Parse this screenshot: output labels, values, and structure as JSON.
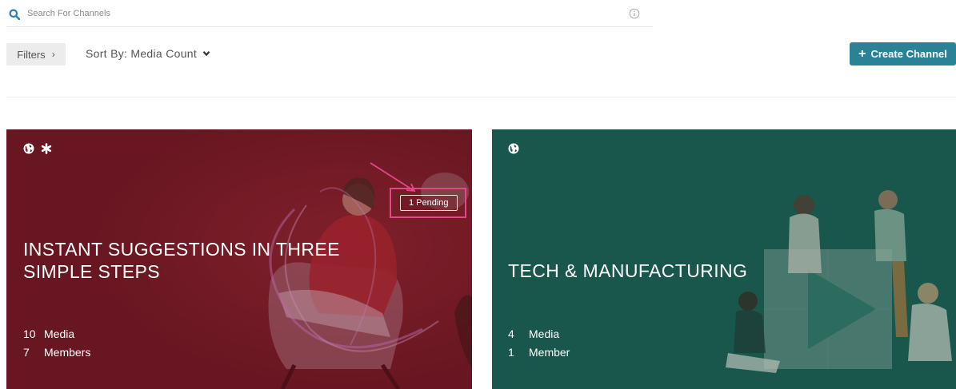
{
  "search": {
    "placeholder": "Search For Channels",
    "value": ""
  },
  "toolbar": {
    "filters_label": "Filters",
    "sort_label": "Sort By: Media Count",
    "create_label": "Create Channel"
  },
  "colors": {
    "accent": "#2a8296",
    "card_1_background": "#6e1a25",
    "card_2_background": "#1d5c50",
    "highlight": "#e4468a"
  },
  "channels": [
    {
      "title": "INSTANT SUGGESTIONS IN THREE SIMPLE STEPS",
      "icons": [
        "globe-icon",
        "asterisk-icon"
      ],
      "pending_badge": "1 Pending",
      "media_count": "10",
      "media_label": "Media",
      "members_count": "7",
      "members_label": "Members"
    },
    {
      "title": "TECH & MANUFACTURING",
      "icons": [
        "globe-icon"
      ],
      "media_count": "4",
      "media_label": "Media",
      "members_count": "1",
      "members_label": "Member"
    }
  ]
}
